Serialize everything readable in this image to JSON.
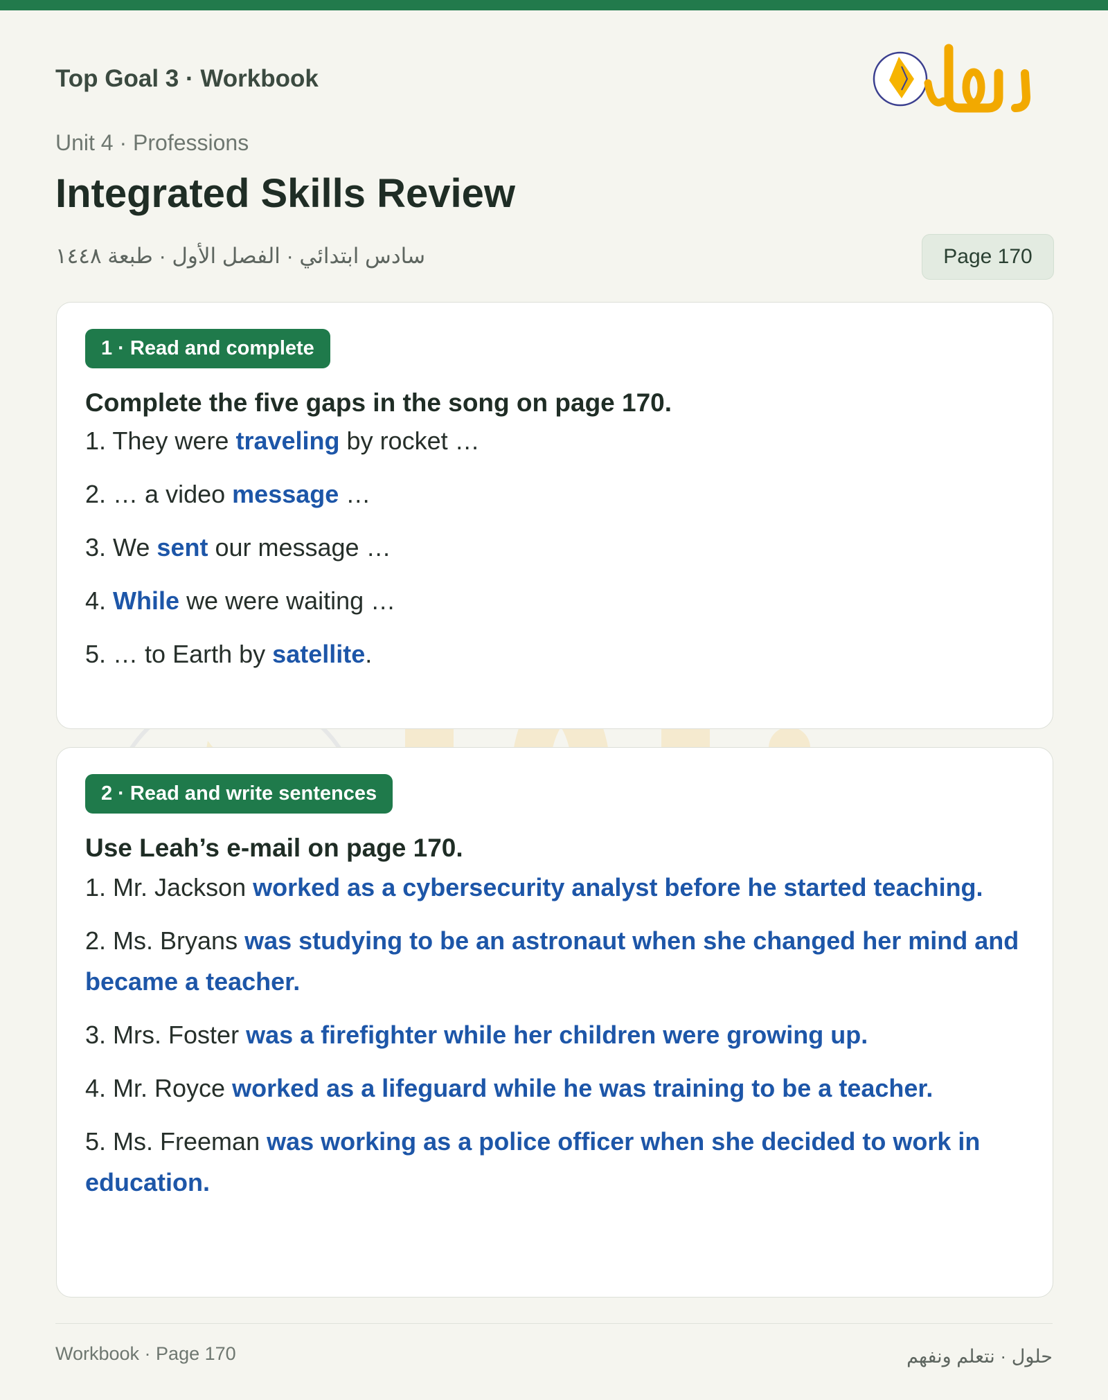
{
  "header": {
    "title": "Top Goal 3 · Workbook",
    "logo_text": "حلول"
  },
  "unit": "Unit 4 · Professions",
  "page_title": "Integrated Skills Review",
  "arabic_meta": "سادس ابتدائي · الفصل الأول · طبعة ١٤٤٨",
  "page_badge": "Page 170",
  "section1": {
    "tag": "1 · Read and complete",
    "instruction": "Complete the five gaps in the song on page 170.",
    "items": [
      {
        "num": "1.",
        "pre": "They were",
        "answer": "traveling",
        "post": "by rocket …"
      },
      {
        "num": "2.",
        "pre": "… a video",
        "answer": "message",
        "post": "…"
      },
      {
        "num": "3.",
        "pre": "We",
        "answer": "sent",
        "post": "our message …"
      },
      {
        "num": "4.",
        "pre": "",
        "answer": "While",
        "post": "we were waiting …"
      },
      {
        "num": "5.",
        "pre": "… to Earth by",
        "answer": "satellite",
        "post": "."
      }
    ]
  },
  "section2": {
    "tag": "2 · Read and write sentences",
    "instruction": "Use Leah’s e-mail on page 170.",
    "items": [
      {
        "num": "1.",
        "pre": "Mr. Jackson",
        "answer": "worked as a cybersecurity analyst before he started teaching."
      },
      {
        "num": "2.",
        "pre": "Ms. Bryans",
        "answer": "was studying to be an astronaut when she changed her mind and became a teacher."
      },
      {
        "num": "3.",
        "pre": "Mrs. Foster",
        "answer": "was a firefighter while her children were growing up."
      },
      {
        "num": "4.",
        "pre": "Mr. Royce",
        "answer": "worked as a lifeguard while he was training to be a teacher."
      },
      {
        "num": "5.",
        "pre": "Ms. Freeman",
        "answer": "was working as a police officer when she decided to work in education."
      }
    ]
  },
  "footer": {
    "left": "Workbook · Page 170",
    "right": "حلول · نتعلم ونفهم"
  },
  "colors": {
    "brand_green": "#227a4c",
    "answer_blue": "#1d56a8",
    "logo_orange": "#f2a900"
  }
}
